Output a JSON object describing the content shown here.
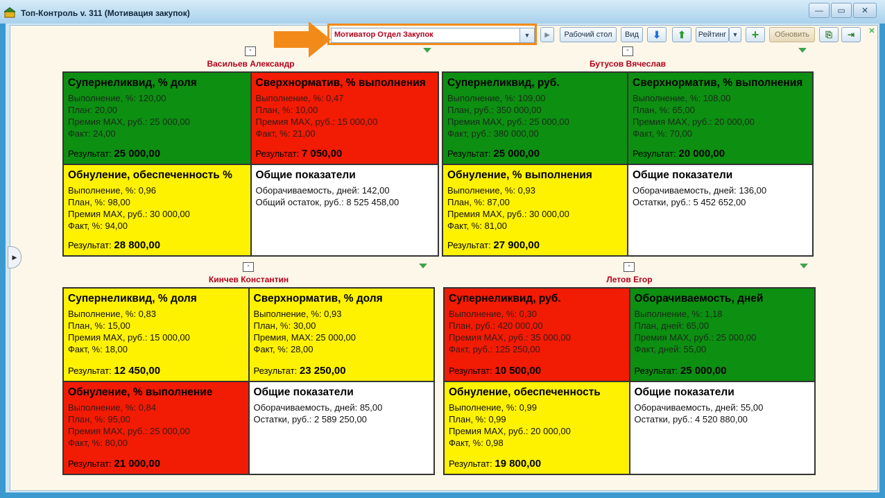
{
  "window": {
    "title": "Топ-Контроль v. 311 (Мотивация закупок)",
    "controls": {
      "minimize": "—",
      "maximize": "▭",
      "close": "✕"
    }
  },
  "toolbar": {
    "selector_value": "Мотиватор Отдел Закупок",
    "buttons": {
      "desktop": "Рабочий стол",
      "view": "Вид",
      "rating": "Рейтинг",
      "refresh": "Обновить"
    },
    "icons": [
      "arrow-down-icon",
      "arrow-up-icon",
      "chevron-down-icon",
      "plus-icon",
      "export-icon",
      "exit-icon"
    ]
  },
  "colors": {
    "green": "#0d8f12",
    "red": "#f21b04",
    "yellow": "#fff200",
    "name": "#b3001b",
    "highlight": "#f28a1a"
  },
  "people": [
    {
      "name": "Васильев Александр",
      "cells": [
        {
          "color": "green",
          "title": "Суперneликвид, % доля",
          "lines": [
            "Выполнение, %: 120,00",
            "План: 20,00",
            "Премия MAX, руб.: 25 000,00",
            "Факт: 24,00"
          ],
          "result_label": "Результат:",
          "result": "25 000,00"
        },
        {
          "color": "red",
          "title": "Сверхнорматив, % выполнения",
          "lines": [
            "Выполнение, %: 0,47",
            "План, %: 10,00",
            "Премия MAX, руб.: 15 000,00",
            "Факт, %: 21,00"
          ],
          "result_label": "Результат:",
          "result": "7 050,00"
        },
        {
          "color": "yellow",
          "title": "Обнуление, обеспеченность %",
          "lines": [
            "Выполнение, %: 0,96",
            "План, %: 98,00",
            "Премия MAX, руб.: 30 000,00",
            "Факт, %: 94,00"
          ],
          "result_label": "Результат:",
          "result": "28 800,00"
        },
        {
          "color": "white",
          "title": "Общие показатели",
          "lines": [
            "Оборачиваемость, дней: 142,00",
            "Общий остаток, руб.: 8 525 458,00"
          ],
          "result_label": "",
          "result": ""
        }
      ]
    },
    {
      "name": "Бутусов Вячеслав",
      "cells": [
        {
          "color": "green",
          "title": "Суперneликвид, руб.",
          "lines": [
            "Выполнение, %: 109,00",
            "План, руб.: 350 000,00",
            "Премия MAX, руб.: 25 000,00",
            "Факт, руб.: 380 000,00"
          ],
          "result_label": "Результат:",
          "result": "25 000,00"
        },
        {
          "color": "green",
          "title": "Сверхнорматив, % выполнения",
          "lines": [
            "Выполнение, %: 108,00",
            "План, %: 65,00",
            "Премия MAX, руб.: 20 000,00",
            "Факт, %: 70,00"
          ],
          "result_label": "Результат:",
          "result": "20 000,00"
        },
        {
          "color": "yellow",
          "title": "Обнуление, % выполнения",
          "lines": [
            "Выполнение, %: 0,93",
            "План, %: 87,00",
            "Премия MAX, руб.: 30 000,00",
            "Факт, %: 81,00"
          ],
          "result_label": "Результат:",
          "result": "27 900,00"
        },
        {
          "color": "white",
          "title": "Общие показатели",
          "lines": [
            "Оборачиваемость, дней: 136,00",
            "Остатки, руб.: 5 452 652,00"
          ],
          "result_label": "",
          "result": ""
        }
      ]
    },
    {
      "name": "Кинчев Константин",
      "cells": [
        {
          "color": "yellow",
          "title": "Суперneликвид, % доля",
          "lines": [
            "Выполнение, %: 0,83",
            "План, %: 15,00",
            "Премия MAX, руб.: 15 000,00",
            "Факт, %: 18,00"
          ],
          "result_label": "Результат:",
          "result": "12 450,00"
        },
        {
          "color": "yellow",
          "title": "Сверхнорматив, % доля",
          "lines": [
            "Выполнение, %: 0,93",
            "План, %: 30,00",
            "Премия, MAX: 25 000,00",
            "Факт, %: 28,00"
          ],
          "result_label": "Результат:",
          "result": "23 250,00"
        },
        {
          "color": "red",
          "title": "Обнуление, % выполнение",
          "lines": [
            "Выполнение, %: 0,84",
            "План, %: 95,00",
            "Премия MAX, руб.: 25 000,00",
            "Факт, %: 80,00"
          ],
          "result_label": "Результат:",
          "result": "21 000,00"
        },
        {
          "color": "white",
          "title": "Общие показатели",
          "lines": [
            "Оборачиваемость, дней: 85,00",
            "Остатки, руб.: 2 589 250,00"
          ],
          "result_label": "",
          "result": ""
        }
      ]
    },
    {
      "name": "Летов Егор",
      "cells": [
        {
          "color": "red",
          "title": "Суперneликвид, руб.",
          "lines": [
            "Выполнение, %: 0,30",
            "План, руб.: 420 000,00",
            "Премия MAX, руб.: 35 000,00",
            "Факт, руб.: 125 250,00"
          ],
          "result_label": "Результат:",
          "result": "10 500,00"
        },
        {
          "color": "green",
          "title": "Оборачиваемость, дней",
          "lines": [
            "Выполнение, %: 1,18",
            "План, дней: 65,00",
            "Премия MAX, руб.: 25 000,00",
            "Факт, дней: 55,00"
          ],
          "result_label": "Результат:",
          "result": "25 000,00"
        },
        {
          "color": "yellow",
          "title": "Обнуление, обеспеченность",
          "lines": [
            "Выполнение, %: 0,99",
            "План, %: 0,99",
            "Премия MAX, руб.: 20 000,00",
            "Факт, %: 0,98"
          ],
          "result_label": "Результат:",
          "result": "19 800,00"
        },
        {
          "color": "white",
          "title": "Общие показатели",
          "lines": [
            "Оборачиваемость, дней: 55,00",
            "Остатки, руб.: 4 520 880,00"
          ],
          "result_label": "",
          "result": ""
        }
      ]
    }
  ]
}
